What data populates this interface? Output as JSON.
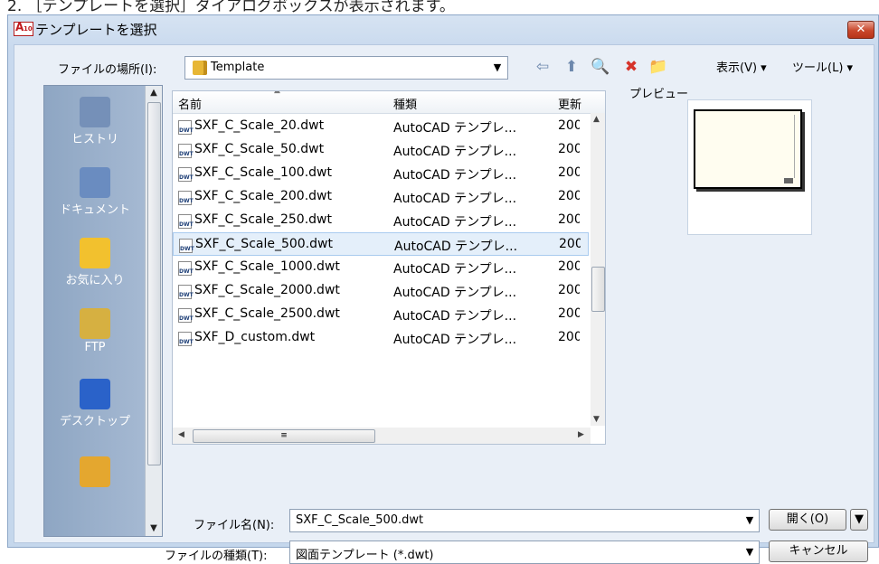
{
  "caption": "2. ［テンプレートを選択］ダイアログボックスが表示されます。",
  "dialog": {
    "title": "テンプレートを選択",
    "close": "✕"
  },
  "toolbar": {
    "lookin_label": "ファイルの場所(I):",
    "lookin_value": "Template",
    "view_menu": "表示(V)",
    "tools_menu": "ツール(L)"
  },
  "places": [
    {
      "label": "ヒストリ",
      "color": "#7590b8"
    },
    {
      "label": "ドキュメント",
      "color": "#6a8cc0"
    },
    {
      "label": "お気に入り",
      "color": "#f2c12e"
    },
    {
      "label": "FTP",
      "color": "#d6b041"
    },
    {
      "label": "デスクトップ",
      "color": "#2a62c9"
    },
    {
      "label": "",
      "color": "#e4a72f"
    }
  ],
  "filelist": {
    "headers": {
      "name": "名前",
      "type": "種類",
      "date": "更新"
    },
    "rows": [
      {
        "name": "SXF_C_Scale_20.dwt",
        "type": "AutoCAD テンプレ...",
        "date": "200"
      },
      {
        "name": "SXF_C_Scale_50.dwt",
        "type": "AutoCAD テンプレ...",
        "date": "200"
      },
      {
        "name": "SXF_C_Scale_100.dwt",
        "type": "AutoCAD テンプレ...",
        "date": "200"
      },
      {
        "name": "SXF_C_Scale_200.dwt",
        "type": "AutoCAD テンプレ...",
        "date": "200"
      },
      {
        "name": "SXF_C_Scale_250.dwt",
        "type": "AutoCAD テンプレ...",
        "date": "200"
      },
      {
        "name": "SXF_C_Scale_500.dwt",
        "type": "AutoCAD テンプレ...",
        "date": "200"
      },
      {
        "name": "SXF_C_Scale_1000.dwt",
        "type": "AutoCAD テンプレ...",
        "date": "200"
      },
      {
        "name": "SXF_C_Scale_2000.dwt",
        "type": "AutoCAD テンプレ...",
        "date": "200"
      },
      {
        "name": "SXF_C_Scale_2500.dwt",
        "type": "AutoCAD テンプレ...",
        "date": "200"
      },
      {
        "name": "SXF_D_custom.dwt",
        "type": "AutoCAD テンプレ...",
        "date": "200"
      }
    ],
    "selected_index": 5
  },
  "preview": {
    "label": "プレビュー"
  },
  "filename": {
    "label": "ファイル名(N):",
    "value": "SXF_C_Scale_500.dwt"
  },
  "filetype": {
    "label": "ファイルの種類(T):",
    "value": "図面テンプレート (*.dwt)"
  },
  "buttons": {
    "open": "開く(O)",
    "cancel": "キャンセル"
  },
  "colors": {
    "selection": "#e4effa",
    "title_bar": "#d6e3f2"
  }
}
